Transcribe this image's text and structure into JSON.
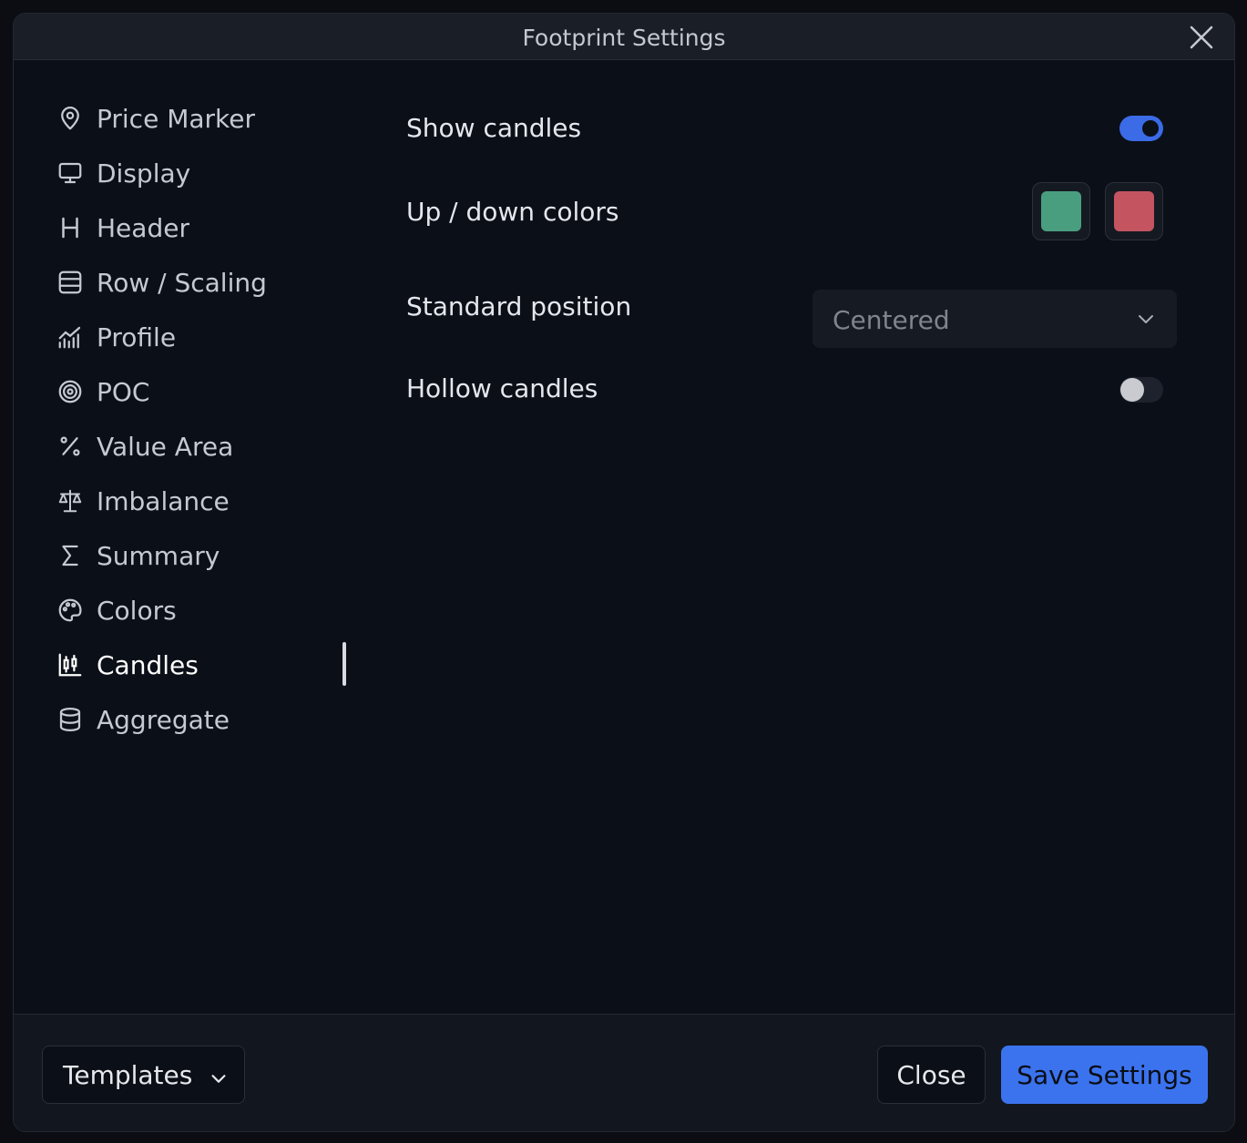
{
  "dialog": {
    "title": "Footprint Settings"
  },
  "sidebar": {
    "items": [
      {
        "label": "Price Marker",
        "icon": "map-pin-icon"
      },
      {
        "label": "Display",
        "icon": "monitor-icon"
      },
      {
        "label": "Header",
        "icon": "heading-icon"
      },
      {
        "label": "Row / Scaling",
        "icon": "rows-icon"
      },
      {
        "label": "Profile",
        "icon": "profile-chart-icon"
      },
      {
        "label": "POC",
        "icon": "target-icon"
      },
      {
        "label": "Value Area",
        "icon": "percent-icon"
      },
      {
        "label": "Imbalance",
        "icon": "scale-icon"
      },
      {
        "label": "Summary",
        "icon": "sigma-icon"
      },
      {
        "label": "Colors",
        "icon": "palette-icon"
      },
      {
        "label": "Candles",
        "icon": "candlestick-icon"
      },
      {
        "label": "Aggregate",
        "icon": "database-icon"
      }
    ],
    "active": "Candles"
  },
  "settings": {
    "show_candles": {
      "label": "Show candles",
      "value": true
    },
    "colors": {
      "label": "Up / down colors",
      "up": "#4a9e80",
      "down": "#c45460"
    },
    "standard_position": {
      "label": "Standard position",
      "value": "Centered"
    },
    "hollow_candles": {
      "label": "Hollow candles",
      "value": false
    }
  },
  "footer": {
    "templates_label": "Templates",
    "close_label": "Close",
    "save_label": "Save Settings"
  },
  "colors": {
    "accent": "#3b73ee",
    "background": "#0b0f17"
  }
}
